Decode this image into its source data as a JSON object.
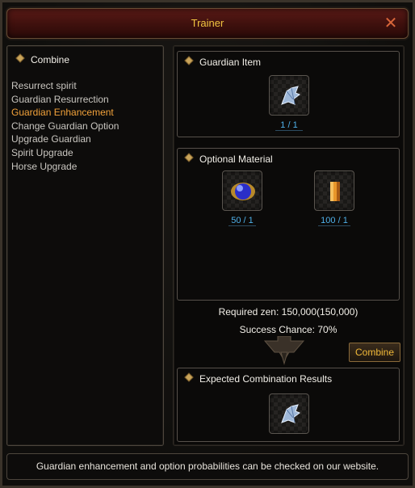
{
  "window": {
    "title": "Trainer"
  },
  "sidebar": {
    "heading": "Combine",
    "items": [
      {
        "label": "Resurrect spirit"
      },
      {
        "label": "Guardian Resurrection"
      },
      {
        "label": "Guardian Enhancement",
        "active": true
      },
      {
        "label": "Change Guardian Option"
      },
      {
        "label": "Upgrade Guardian"
      },
      {
        "label": "Spirit Upgrade"
      },
      {
        "label": "Horse Upgrade"
      }
    ]
  },
  "guardian_item": {
    "heading": "Guardian Item",
    "count": "1 / 1",
    "icon": "guardian-crystal-icon"
  },
  "optional_material": {
    "heading": "Optional Material",
    "items": [
      {
        "count": "50 / 1",
        "icon": "blue-orb-icon"
      },
      {
        "count": "100 / 1",
        "icon": "orange-scroll-icon"
      }
    ]
  },
  "combine": {
    "required_zen": "Required zen: 150,000(150,000)",
    "success_chance": "Success Chance: 70%",
    "button_label": "Combine"
  },
  "expected": {
    "heading": "Expected Combination Results",
    "icon": "guardian-crystal-icon"
  },
  "footer": {
    "text": "Guardian enhancement and option probabilities can be checked on our website."
  },
  "colors": {
    "accent": "#f0c340",
    "active_menu": "#f2a23a",
    "count": "#4fb1ea",
    "title_bar": "#5a1a16"
  }
}
